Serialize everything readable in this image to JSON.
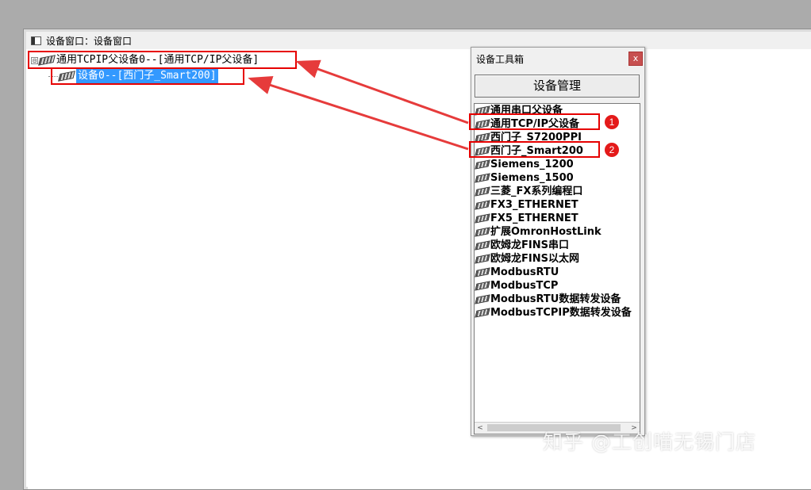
{
  "window": {
    "title": "设备窗口：设备窗口"
  },
  "tree": {
    "root": {
      "expander": "⊟",
      "label": "通用TCPIP父设备0--[通用TCP/IP父设备]"
    },
    "child": {
      "label": "设备0--[西门子_Smart200]"
    }
  },
  "toolbox": {
    "title": "设备工具箱",
    "close_label": "x",
    "manage_button": "设备管理",
    "items": [
      "通用串口父设备",
      "通用TCP/IP父设备",
      "西门子_S7200PPI",
      "西门子_Smart200",
      "Siemens_1200",
      "Siemens_1500",
      "三菱_FX系列编程口",
      "FX3_ETHERNET",
      "FX5_ETHERNET",
      "扩展OmronHostLink",
      "欧姆龙FINS串口",
      "欧姆龙FINS以太网",
      "ModbusRTU",
      "ModbusTCP",
      "ModbusRTU数据转发设备",
      "ModbusTCPIP数据转发设备"
    ],
    "scroll_left": "<",
    "scroll_right": ">"
  },
  "annotations": {
    "badge1": "1",
    "badge2": "2",
    "color": "#e60000"
  },
  "watermark": "知乎 @工创喵无锡门店"
}
